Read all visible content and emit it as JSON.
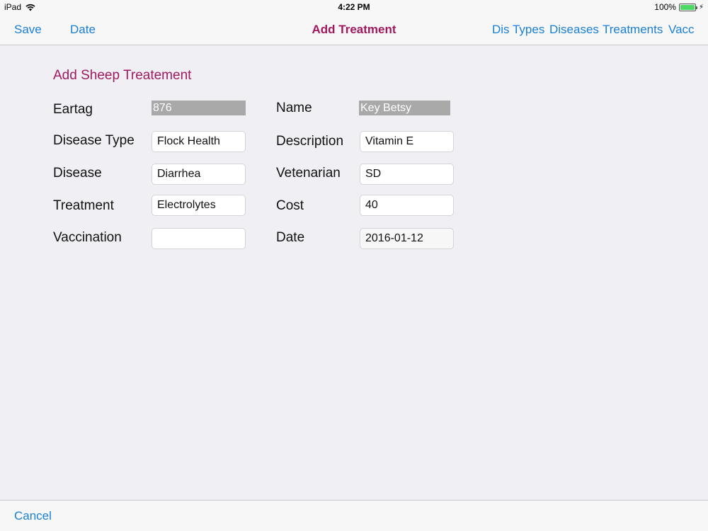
{
  "status_bar": {
    "device": "iPad",
    "time": "4:22 PM",
    "battery": "100%"
  },
  "navbar": {
    "title": "Add Treatment",
    "left_buttons": [
      {
        "label": "Save"
      },
      {
        "label": "Date"
      }
    ],
    "right_buttons": [
      {
        "label": "Dis Types"
      },
      {
        "label": "Diseases"
      },
      {
        "label": "Treatments"
      },
      {
        "label": "Vacc"
      }
    ]
  },
  "form": {
    "title": "Add Sheep Treatement",
    "eartag": {
      "label": "Eartag",
      "value": "876"
    },
    "name": {
      "label": "Name",
      "value": "Key Betsy"
    },
    "disease_type": {
      "label": "Disease Type",
      "value": "Flock Health"
    },
    "description": {
      "label": "Description",
      "value": "Vitamin E"
    },
    "disease": {
      "label": "Disease",
      "value": "Diarrhea"
    },
    "vetenarian": {
      "label": "Vetenarian",
      "value": "SD"
    },
    "treatment": {
      "label": "Treatment",
      "value": "Electrolytes"
    },
    "cost": {
      "label": "Cost",
      "value": "40"
    },
    "vaccination": {
      "label": "Vaccination",
      "value": ""
    },
    "date": {
      "label": "Date",
      "value": "2016-01-12"
    }
  },
  "toolbar": {
    "cancel_label": "Cancel"
  },
  "colors": {
    "accent_blue": "#1a7fd6",
    "title_magenta": "#a0195f",
    "battery_green": "#4cd964"
  }
}
